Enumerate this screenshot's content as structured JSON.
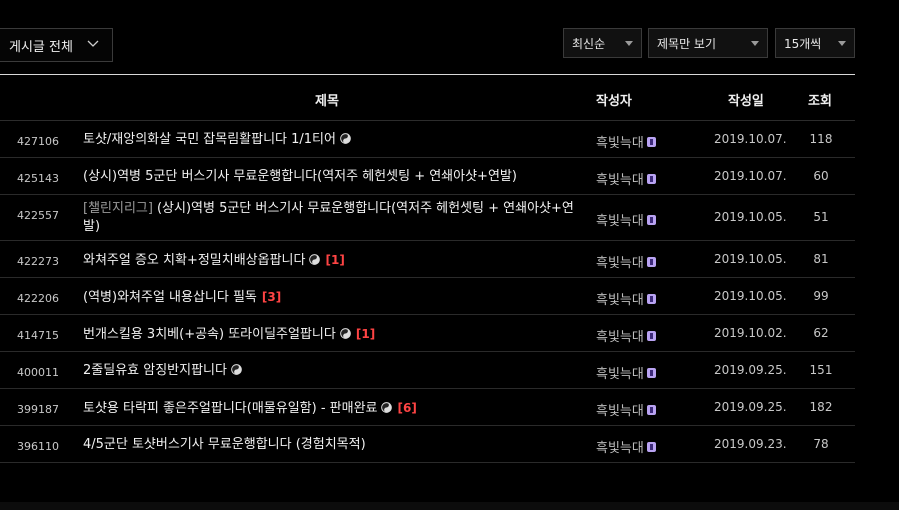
{
  "filters": {
    "board": "게시글 전체",
    "sort": "최신순",
    "view": "제목만 보기",
    "count": "15개씩"
  },
  "columns": {
    "title": "제목",
    "author": "작성자",
    "date": "작성일",
    "views": "조회"
  },
  "rows": [
    {
      "num": "427106",
      "prefix": "",
      "title": "토샷/재앙의화살 국민 잡목림활팝니다 1/1티어",
      "icon": true,
      "comments": "",
      "author": "흑빛늑대",
      "date": "2019.10.07.",
      "views": "118"
    },
    {
      "num": "425143",
      "prefix": "",
      "title": "(상시)역병 5군단 버스기사 무료운행합니다(역저주 헤헌셋팅 + 연쇄아샷+연발)",
      "icon": false,
      "comments": "",
      "author": "흑빛늑대",
      "date": "2019.10.07.",
      "views": "60"
    },
    {
      "num": "422557",
      "prefix": "[챌린지리그]",
      "title": "(상시)역병 5군단 버스기사 무료운행합니다(역저주 헤헌셋팅 + 연쇄아샷+연발)",
      "icon": false,
      "comments": "",
      "author": "흑빛늑대",
      "date": "2019.10.05.",
      "views": "51"
    },
    {
      "num": "422273",
      "prefix": "",
      "title": "와쳐주얼 증오 치확+정밀치배상옵팝니다",
      "icon": true,
      "comments": "[1]",
      "author": "흑빛늑대",
      "date": "2019.10.05.",
      "views": "81"
    },
    {
      "num": "422206",
      "prefix": "",
      "title": "(역병)와쳐주얼 내용삽니다 필독",
      "icon": false,
      "comments": "[3]",
      "author": "흑빛늑대",
      "date": "2019.10.05.",
      "views": "99"
    },
    {
      "num": "414715",
      "prefix": "",
      "title": "번개스킬용 3치베(+공속) 또라이딜주얼팝니다",
      "icon": true,
      "comments": "[1]",
      "author": "흑빛늑대",
      "date": "2019.10.02.",
      "views": "62"
    },
    {
      "num": "400011",
      "prefix": "",
      "title": "2줄딜유효 암징반지팝니다",
      "icon": true,
      "comments": "",
      "author": "흑빛늑대",
      "date": "2019.09.25.",
      "views": "151"
    },
    {
      "num": "399187",
      "prefix": "",
      "title": "토샷용 타락피 좋은주얼팝니다(매물유일함) - 판매완료",
      "icon": true,
      "comments": "[6]",
      "author": "흑빛늑대",
      "date": "2019.09.25.",
      "views": "182"
    },
    {
      "num": "396110",
      "prefix": "",
      "title": "4/5군단 토샷버스기사 무료운행합니다 (경험치목적)",
      "icon": false,
      "comments": "",
      "author": "흑빛늑대",
      "date": "2019.09.23.",
      "views": "78"
    }
  ]
}
